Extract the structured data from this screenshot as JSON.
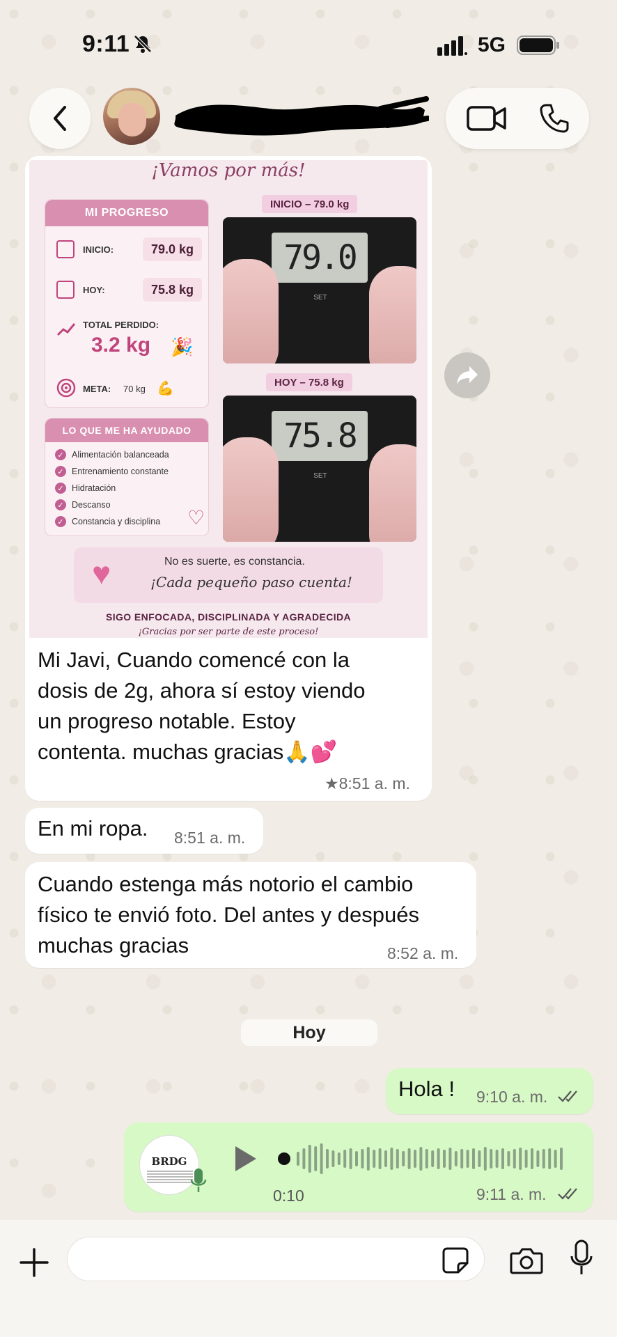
{
  "status_bar": {
    "time": "9:11",
    "network": "5G"
  },
  "header": {
    "back_icon": "chevron-left-icon",
    "video_icon": "video-camera-icon",
    "call_icon": "phone-icon"
  },
  "image_card": {
    "title": "¡Vamos por más!",
    "progress": {
      "heading": "MI PROGRESO",
      "start_label": "INICIO:",
      "start_value": "79.0 kg",
      "today_label": "HOY:",
      "today_value": "75.8 kg",
      "lost_label": "TOTAL PERDIDO:",
      "lost_value": "3.2 kg",
      "goal_label": "META:",
      "goal_value": "70 kg"
    },
    "helped": {
      "heading": "LO QUE ME HA AYUDADO",
      "items": [
        "Alimentación balanceada",
        "Entrenamiento constante",
        "Hidratación",
        "Descanso",
        "Constancia y disciplina"
      ]
    },
    "scale_start_label": "INICIO – 79.0 kg",
    "scale_start_display": "79.0",
    "scale_today_label": "HOY – 75.8 kg",
    "scale_today_display": "75.8",
    "scale_set": "SET",
    "quote_line1": "No es suerte, es constancia.",
    "quote_line2": "¡Cada pequeño paso cuenta!",
    "motto": "SIGO ENFOCADA, DISCIPLINADA Y AGRADECIDA",
    "thanks": "¡Gracias por ser parte de este proceso!"
  },
  "messages": [
    {
      "direction": "in",
      "text_lines": [
        "Mi Javi, Cuando comencé con la",
        "dosis de 2g, ahora sí estoy viendo",
        "un progreso notable. Estoy",
        "contenta. muchas gracias🙏💕"
      ],
      "time": "★8:51 a. m."
    },
    {
      "direction": "in",
      "text": "En mi ropa.",
      "time": "8:51 a. m."
    },
    {
      "direction": "in",
      "text_lines": [
        "Cuando estenga más notorio el cambio",
        "físico te envió foto. Del antes y después",
        "muchas gracias"
      ],
      "time": "8:52 a. m."
    },
    {
      "direction": "out",
      "text": "Hola !",
      "time": "9:10 a. m."
    }
  ],
  "date_divider": "Hoy",
  "voice_note": {
    "thumb_text": "BRDG",
    "duration": "0:10",
    "time": "9:11 a. m."
  },
  "composer": {
    "placeholder": ""
  },
  "colors": {
    "outgoing_bubble": "#d7f9c6",
    "incoming_bubble": "#ffffff",
    "accent_pink": "#c0457c"
  }
}
